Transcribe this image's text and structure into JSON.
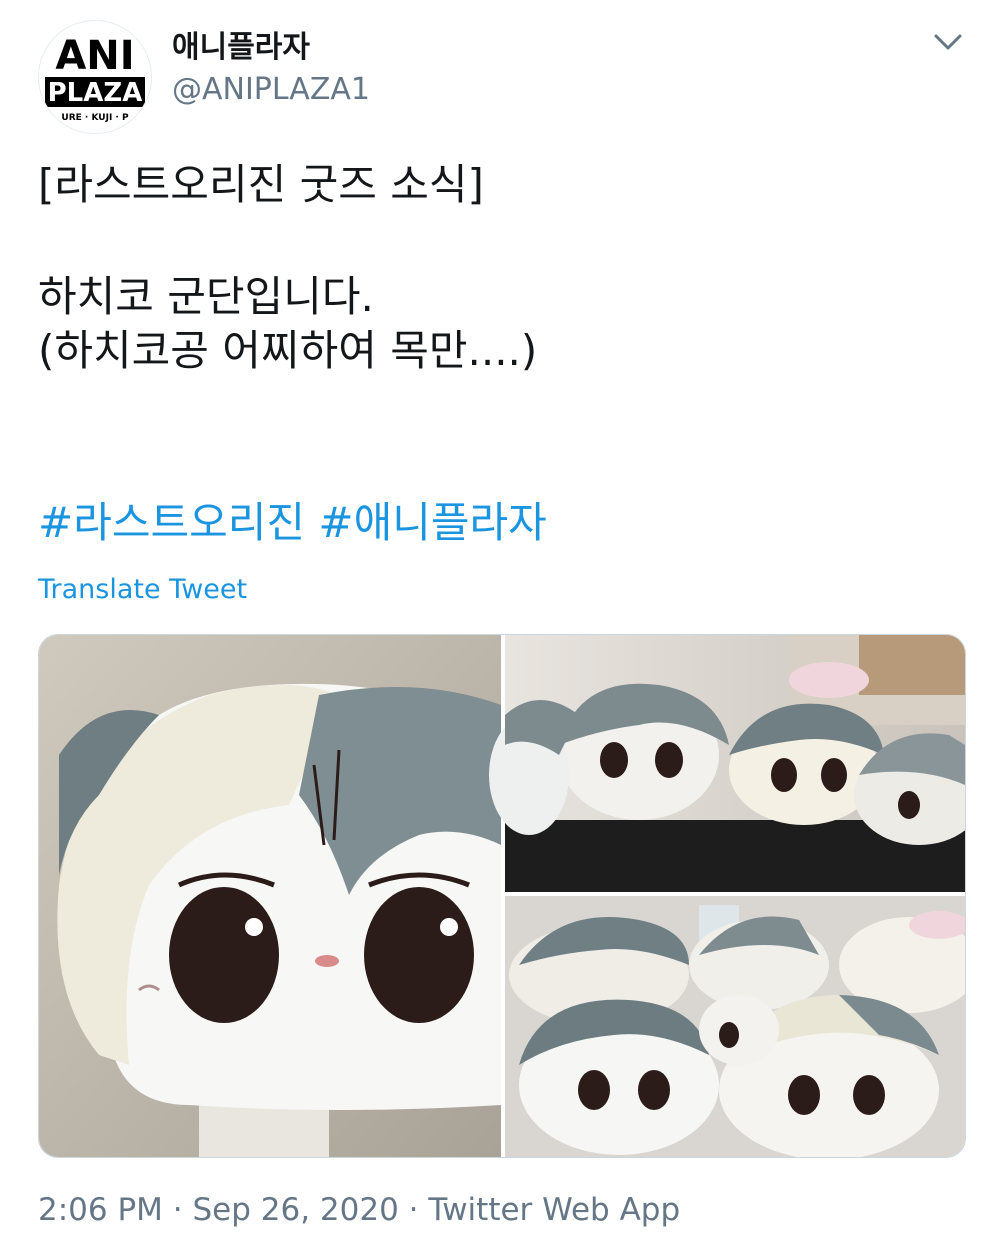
{
  "profile": {
    "display_name": "애니플라자",
    "handle": "@ANIPLAZA1",
    "avatar_logo_text": [
      "ANI",
      "PLAZA",
      "URE · KUJI · P"
    ]
  },
  "menu": {
    "icon": "chevron-down-icon"
  },
  "tweet": {
    "lines": [
      "[라스트오리진 굿즈 소식]",
      "",
      "하치코 군단입니다.",
      "(하치코공 어찌하여 목만....)"
    ],
    "hashtags": [
      "#라스트오리진",
      "#애니플라자"
    ],
    "translate_label": "Translate Tweet"
  },
  "media": {
    "images": [
      "plush-closeup-photo",
      "plush-group-photo-1",
      "plush-group-photo-2"
    ]
  },
  "meta": {
    "time": "2:06 PM",
    "separator": " · ",
    "date": "Sep 26, 2020",
    "source": "Twitter Web App"
  },
  "colors": {
    "text": "#14171a",
    "secondary": "#657786",
    "link": "#1b95e0",
    "border": "#ccd6dd"
  }
}
